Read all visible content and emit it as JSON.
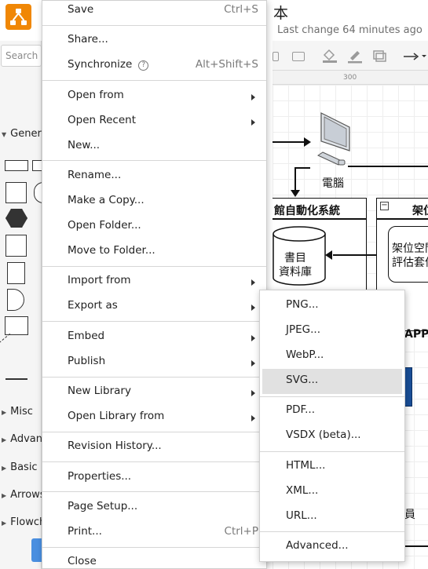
{
  "app": {
    "document_title": "本",
    "last_change": "Last change 64 minutes ago",
    "search_placeholder": "Search S",
    "ruler_mark": "300",
    "sections": [
      {
        "label": "Genera"
      },
      {
        "label": "Misc"
      },
      {
        "label": "Advan"
      },
      {
        "label": "Basic"
      },
      {
        "label": "Arrows"
      },
      {
        "label": "Flowch"
      }
    ],
    "diagram": {
      "computer_label": "電腦",
      "system_title": "館自動化系統",
      "db_label_1": "書目",
      "db_label_2": "資料庫",
      "right_title": "架位",
      "right_box_1": "架位空間",
      "right_box_2": "評估套件",
      "app_label": "APP",
      "staff_label": "員"
    }
  },
  "menu": {
    "save": "Save",
    "save_shortcut": "Ctrl+S",
    "share": "Share...",
    "synchronize": "Synchronize",
    "help_glyph": "?",
    "synchronize_shortcut": "Alt+Shift+S",
    "open_from": "Open from",
    "open_recent": "Open Recent",
    "new": "New...",
    "rename": "Rename...",
    "make_copy": "Make a Copy...",
    "open_folder": "Open Folder...",
    "move_to_folder": "Move to Folder...",
    "import_from": "Import from",
    "export_as": "Export as",
    "embed": "Embed",
    "publish": "Publish",
    "new_library": "New Library",
    "open_library_from": "Open Library from",
    "revision_history": "Revision History...",
    "properties": "Properties...",
    "page_setup": "Page Setup...",
    "print": "Print...",
    "print_shortcut": "Ctrl+P",
    "close": "Close"
  },
  "export_submenu": {
    "png": "PNG...",
    "jpeg": "JPEG...",
    "webp": "WebP...",
    "svg": "SVG...",
    "pdf": "PDF...",
    "vsdx": "VSDX (beta)...",
    "html": "HTML...",
    "xml": "XML...",
    "url": "URL...",
    "advanced": "Advanced...",
    "highlighted": "SVG..."
  },
  "colors": {
    "logo": "#f08705",
    "highlight": "#e1e1e1",
    "app_tile_blue": "#1a4f99"
  },
  "icons": [
    "drawio-logo-icon",
    "panel-layout-icon",
    "help-icon",
    "submenu-arrow-icon",
    "fill-color-icon",
    "line-color-icon",
    "shadow-icon",
    "connector-icon",
    "computer-icon"
  ]
}
